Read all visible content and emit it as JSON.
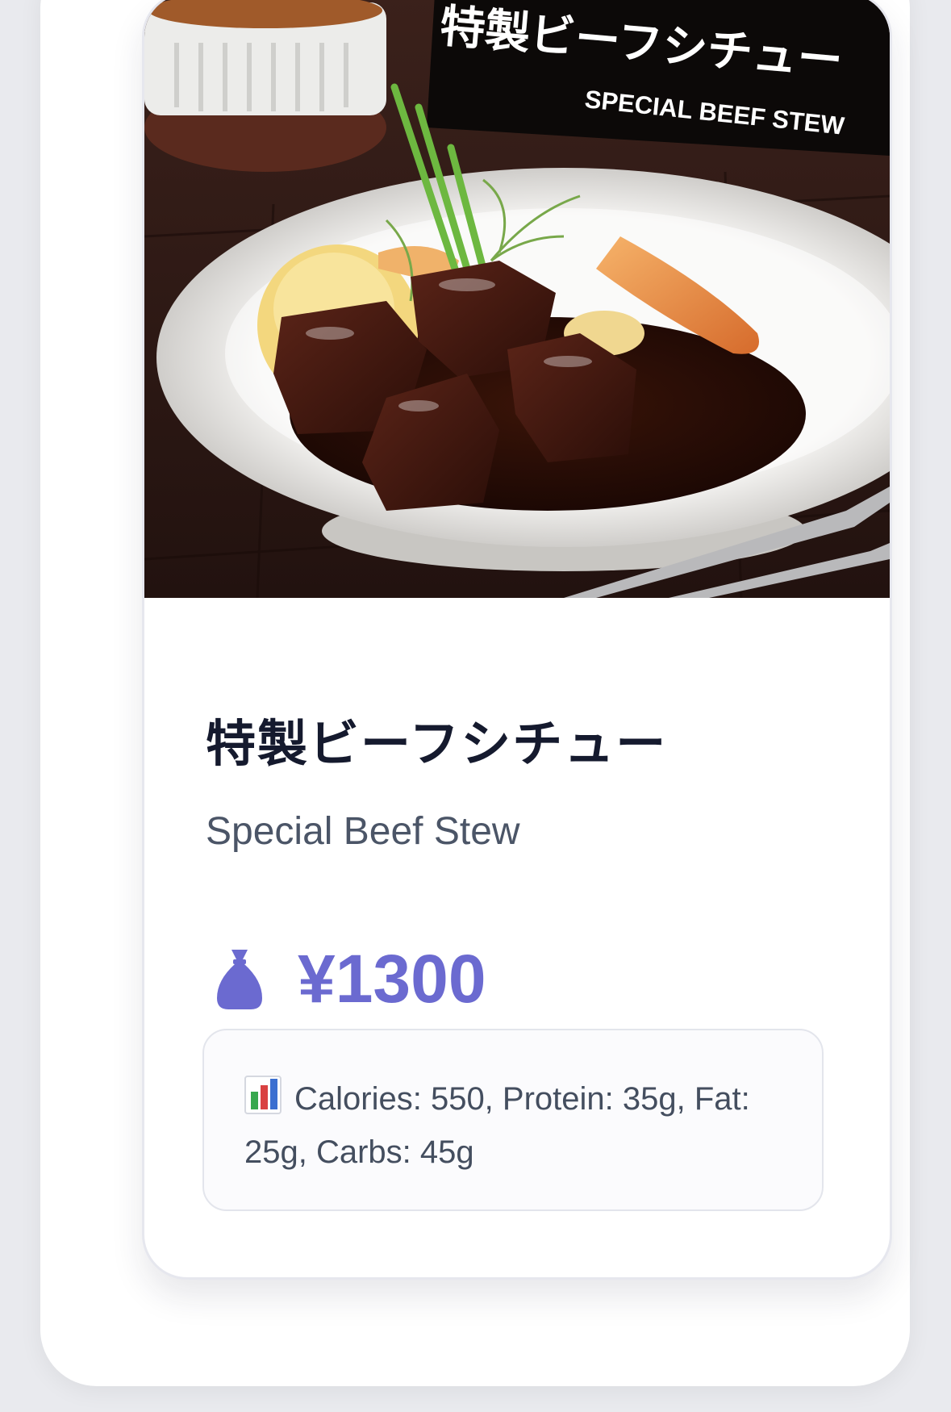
{
  "item": {
    "photo_overlay": {
      "title_jp": "特製ビーフシチュー",
      "title_en": "SPECIAL BEEF STEW"
    },
    "title_jp": "特製ビーフシチュー",
    "title_en": "Special Beef Stew",
    "price": "¥1300",
    "price_icon": "money-bag-icon",
    "nutrition_icon": "bar-chart-icon",
    "nutrition": "Calories: 550, Protein: 35g, Fat: 25g, Carbs: 45g"
  },
  "colors": {
    "accent": "#6b6ad0",
    "title": "#151a2e",
    "subtitle": "#4b5567",
    "background": "#e9eaee"
  }
}
